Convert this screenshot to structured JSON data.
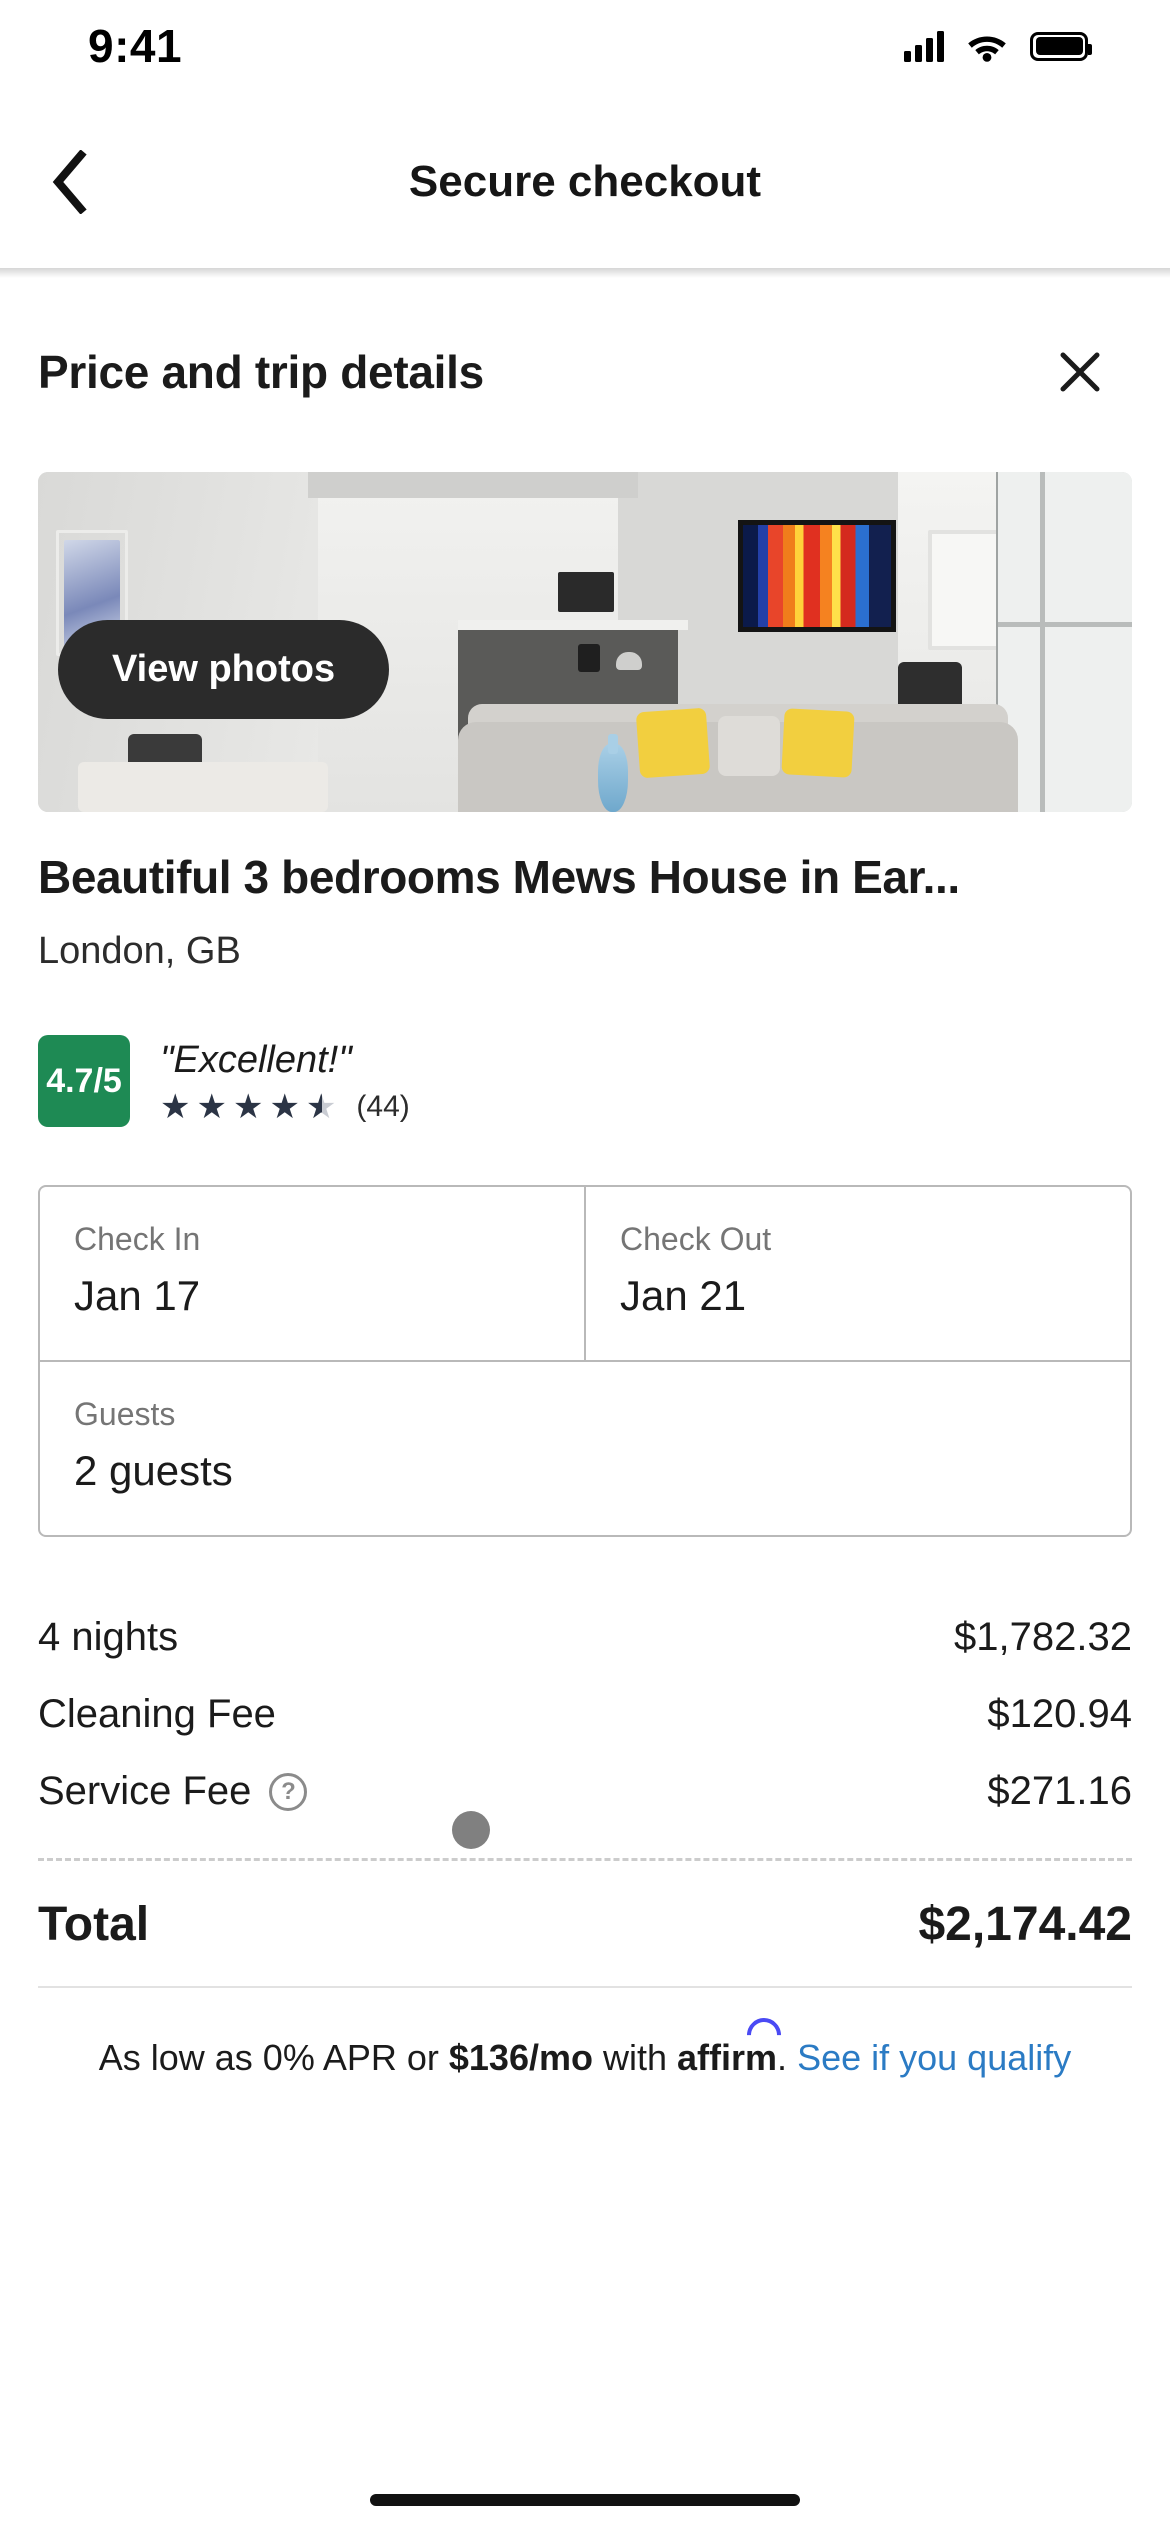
{
  "status_bar": {
    "time": "9:41",
    "signal_icon": "cellular-signal-icon",
    "wifi_icon": "wifi-icon",
    "battery_icon": "battery-full-icon"
  },
  "nav": {
    "back_icon": "chevron-left-icon",
    "title": "Secure checkout"
  },
  "sheet": {
    "title": "Price and trip details",
    "close_icon": "close-icon"
  },
  "property": {
    "view_photos_label": "View photos",
    "title": "Beautiful 3 bedrooms Mews House in Ear...",
    "location": "London, GB"
  },
  "rating": {
    "score": "4.7/5",
    "badge_color": "#1E8A54",
    "label": "\"Excellent!\"",
    "stars_filled": 4,
    "stars_half": 1,
    "stars_total": 5,
    "star_color": "#2B3445",
    "review_count": "(44)"
  },
  "booking": {
    "check_in_label": "Check In",
    "check_in_value": "Jan 17",
    "check_out_label": "Check Out",
    "check_out_value": "Jan 21",
    "guests_label": "Guests",
    "guests_value": "2 guests"
  },
  "price_breakdown": {
    "rows": [
      {
        "label": "4 nights",
        "amount": "$1,782.32",
        "has_help_icon": false
      },
      {
        "label": "Cleaning Fee",
        "amount": "$120.94",
        "has_help_icon": false
      },
      {
        "label": "Service Fee",
        "amount": "$271.16",
        "has_help_icon": true
      }
    ],
    "total_label": "Total",
    "total_amount": "$2,174.42"
  },
  "financing": {
    "prefix": "As low as 0% APR or ",
    "monthly": "$136/mo",
    "with_text": " with ",
    "brand": "affirm",
    "period": ". ",
    "link_text": "See if you qualify",
    "link_color": "#2B7BC4",
    "brand_accent": "#4A4AF4"
  }
}
